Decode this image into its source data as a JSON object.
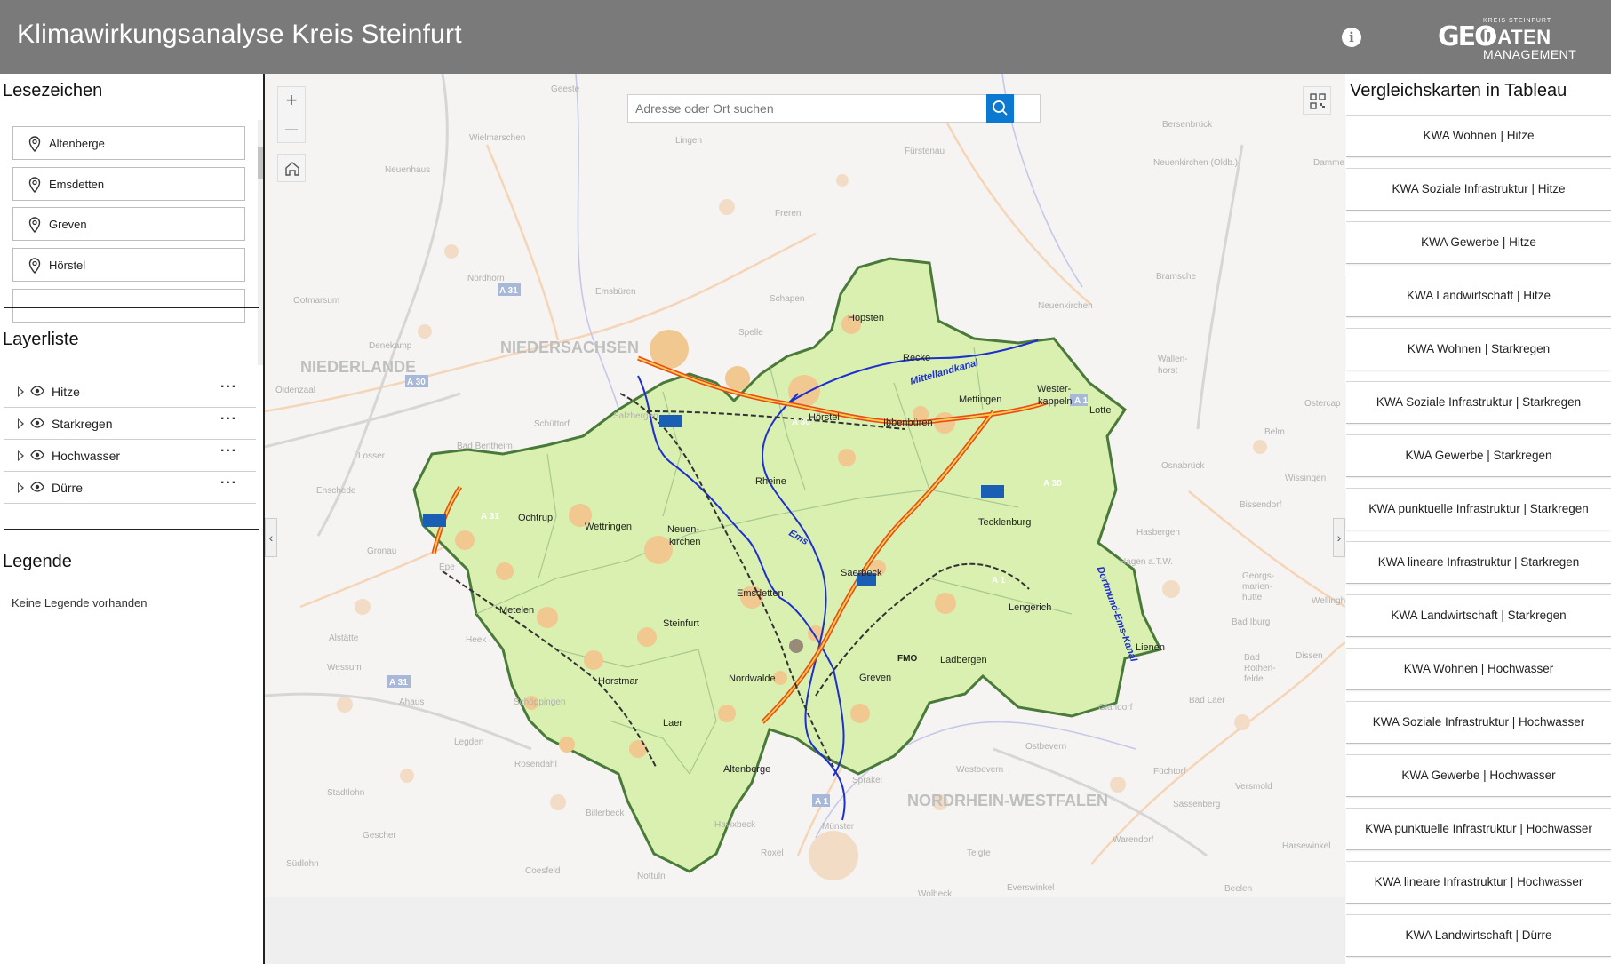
{
  "header": {
    "title": "Klimawirkungsanalyse Kreis Steinfurt",
    "info_icon": "info-icon",
    "logo": {
      "kreis": "KREIS STEINFURT",
      "geo": "GEO",
      "daten": "DATEN",
      "management": "MANAGEMENT"
    }
  },
  "left": {
    "bookmarks_title": "Lesezeichen",
    "bookmarks": [
      {
        "label": "Altenberge",
        "icon": "map-pin-icon"
      },
      {
        "label": "Emsdetten",
        "icon": "map-pin-icon"
      },
      {
        "label": "Greven",
        "icon": "map-pin-icon"
      },
      {
        "label": "Hörstel",
        "icon": "map-pin-icon"
      }
    ],
    "layers_title": "Layerliste",
    "layers": [
      {
        "name": "Hitze",
        "more": "···"
      },
      {
        "name": "Starkregen",
        "more": "···"
      },
      {
        "name": "Hochwasser",
        "more": "···"
      },
      {
        "name": "Dürre",
        "more": "···"
      }
    ],
    "legend_title": "Legende",
    "legend_empty": "Keine Legende vorhanden"
  },
  "map": {
    "search_placeholder": "Adresse oder Ort suchen",
    "zoom_in": "+",
    "zoom_out": "—",
    "region_labels": [
      "NIEDERLANDE",
      "NIEDERSACHSEN",
      "NORDRHEIN-WESTFALEN"
    ],
    "towns": [
      "Hopsten",
      "Recke",
      "Mettingen",
      "Wester-",
      "kappeln",
      "Lotte",
      "Hörstel",
      "Ibbenbüren",
      "Rheine",
      "Tecklenburg",
      "Ochtrup",
      "Wettringen",
      "Neuen-",
      "kirchen",
      "Saerbeck",
      "Lengerich",
      "Metelen",
      "Emsdetten",
      "Steinfurt",
      "Lienen",
      "Horstmar",
      "Nordwalde",
      "Greven",
      "Ladbergen",
      "FMO",
      "Laer",
      "Altenberge"
    ],
    "waterways": [
      "Mittellandkanal",
      "Dortmund-Ems-Kanal",
      "Ems"
    ],
    "road_shields": [
      "A 30",
      "A 30",
      "A 31",
      "A 1",
      "A 31",
      "A 30",
      "A 1",
      "A 31",
      "A 1"
    ],
    "background_places": [
      "Geeste",
      "Lingen",
      "Wielmarschen",
      "Neuenhaus",
      "Fürstenau",
      "Bersenbrück",
      "Neuenkirchen (Oldb.)",
      "Damme",
      "Freren",
      "Nordhorn",
      "Emsbüren",
      "Schapen",
      "Spelle",
      "Bramsche",
      "Osnabrück",
      "Neuenkirchen",
      "Wallen-",
      "horst",
      "Belm",
      "Ostercap",
      "Wissingen",
      "Bissendorf",
      "Hasbergen",
      "Hagen a.T.W.",
      "Georgs-",
      "marien-",
      "hütte",
      "Wellingh",
      "Bad Iburg",
      "Bad",
      "Rothen-",
      "felde",
      "Dissen",
      "Bad Laer",
      "Glandorf",
      "Füchtorf",
      "Versmold",
      "Sassenberg",
      "Harsewinkel",
      "Warendorf",
      "Everswinkel",
      "Beelen",
      "Ostbevern",
      "Westbevern",
      "Telgte",
      "Wolbeck",
      "Münster",
      "Sprakel",
      "Havixbeck",
      "Roxel",
      "Nottuln",
      "Billerbeck",
      "Coesfeld",
      "Legden",
      "Rosendahl",
      "Schöppingen",
      "Heek",
      "Ahaus",
      "Stadtlohn",
      "Gescher",
      "Südlohn",
      "Wessum",
      "Alstätte",
      "Epe",
      "Gronau",
      "Enschede",
      "Losser",
      "Oldenzaal",
      "Ootmarsum",
      "Denekamp",
      "Bad Bentheim",
      "Schüttorf",
      "Salzbergen",
      "Ibbenbüren"
    ]
  },
  "right": {
    "title": "Vergleichskarten in Tableau",
    "cards": [
      "KWA Wohnen | Hitze",
      "KWA Soziale Infrastruktur | Hitze",
      "KWA Gewerbe | Hitze",
      "KWA Landwirtschaft | Hitze",
      "KWA Wohnen | Starkregen",
      "KWA Soziale Infrastruktur | Starkregen",
      "KWA Gewerbe | Starkregen",
      "KWA punktuelle Infrastruktur | Starkregen",
      "KWA lineare Infrastruktur | Starkregen",
      "KWA Landwirtschaft | Starkregen",
      "KWA Wohnen | Hochwasser",
      "KWA Soziale Infrastruktur | Hochwasser",
      "KWA Gewerbe | Hochwasser",
      "KWA punktuelle Infrastruktur | Hochwasser",
      "KWA lineare Infrastruktur | Hochwasser",
      "KWA Landwirtschaft | Dürre"
    ]
  },
  "colors": {
    "header": "#7a7a7a",
    "accent": "#0b79d0",
    "district_fill": "#d8f0b0",
    "district_border": "#4a7a3a"
  }
}
